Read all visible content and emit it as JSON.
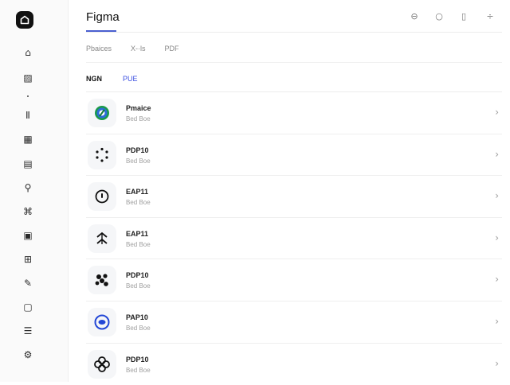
{
  "sidebar": {
    "items": [
      {
        "icon": "home-icon",
        "glyph": "⌂"
      },
      {
        "icon": "image-icon",
        "glyph": "▨"
      },
      {
        "icon": "bar-icon",
        "glyph": "Ⅱ"
      },
      {
        "icon": "grid-icon",
        "glyph": "▦"
      },
      {
        "icon": "layers-icon",
        "glyph": "▤"
      },
      {
        "icon": "person-icon",
        "glyph": "⚲"
      },
      {
        "icon": "link-icon",
        "glyph": "⌘"
      },
      {
        "icon": "frame-icon",
        "glyph": "▣"
      },
      {
        "icon": "tag-icon",
        "glyph": "⊞"
      },
      {
        "icon": "pen-icon",
        "glyph": "✎"
      },
      {
        "icon": "box-icon",
        "glyph": "▢"
      },
      {
        "icon": "stack-icon",
        "glyph": "☰"
      },
      {
        "icon": "settings-icon",
        "glyph": "⚙"
      }
    ]
  },
  "header": {
    "title": "Figma",
    "actions": [
      {
        "icon": "minus-circle-icon",
        "glyph": "⊖"
      },
      {
        "icon": "circle-icon",
        "glyph": "○"
      },
      {
        "icon": "battery-icon",
        "glyph": "▯"
      },
      {
        "icon": "divide-icon",
        "glyph": "÷"
      }
    ]
  },
  "subtabs": [
    "Pbaices",
    "X-·ls",
    "PDF"
  ],
  "filters": {
    "active": "NGN",
    "alt": "PUE"
  },
  "items": [
    {
      "name": "Pmaice",
      "sub": "Bed Boe",
      "icon": "green-logo-icon"
    },
    {
      "name": "PDP10",
      "sub": "Bed Boe",
      "icon": "dots-ring-icon"
    },
    {
      "name": "EAP11",
      "sub": "Bed Boe",
      "icon": "ring-icon"
    },
    {
      "name": "EAP11",
      "sub": "Bed Boe",
      "icon": "chevrons-icon"
    },
    {
      "name": "PDP10",
      "sub": "Bed Boe",
      "icon": "cluster-icon"
    },
    {
      "name": "PAP10",
      "sub": "Bed Boe",
      "icon": "blue-circle-icon"
    },
    {
      "name": "PDP10",
      "sub": "Bed Boe",
      "icon": "flower-icon"
    }
  ],
  "chevron": "›"
}
